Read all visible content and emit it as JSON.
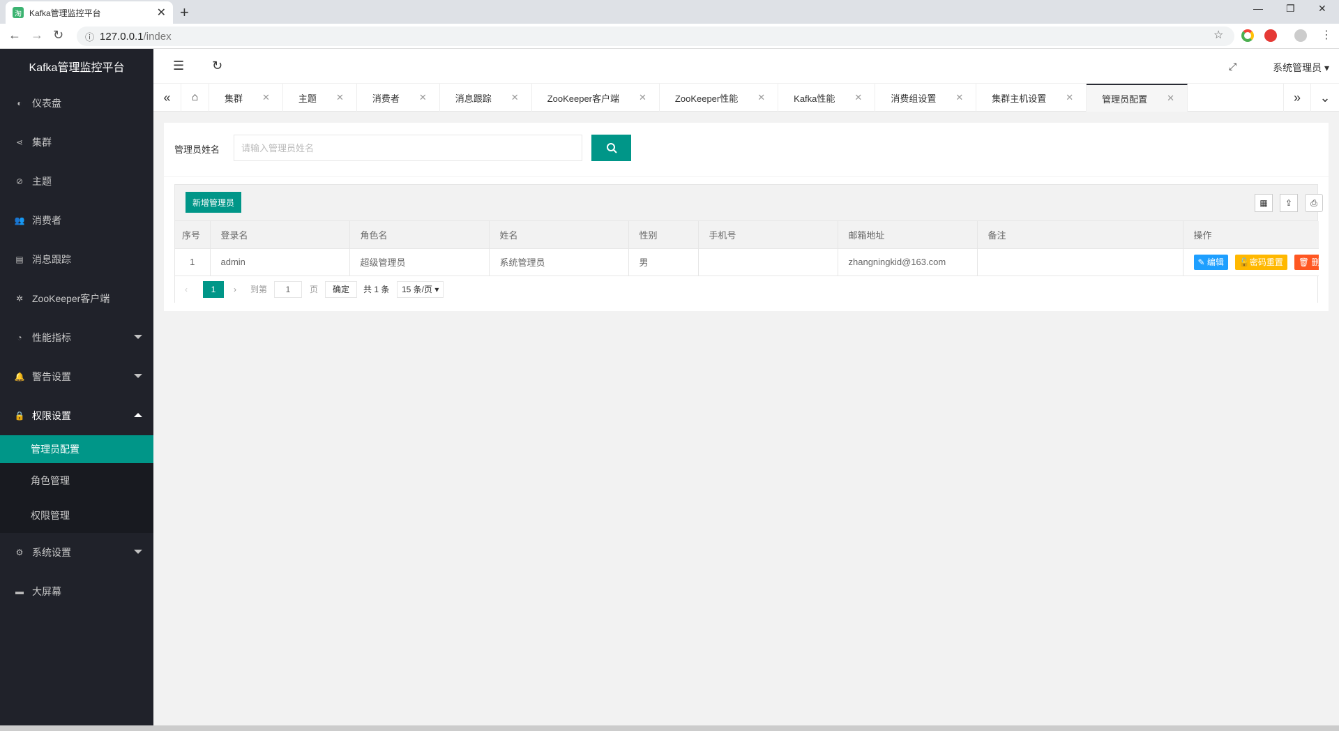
{
  "browser": {
    "tab_title": "Kafka管理监控平台",
    "tab_favicon": "淘",
    "url_host": "127.0.0.1",
    "url_path": "/index"
  },
  "sidebar": {
    "logo": "Kafka管理监控平台",
    "items": [
      {
        "label": "仪表盘",
        "icon": "◐"
      },
      {
        "label": "集群",
        "icon": "⋖"
      },
      {
        "label": "主题",
        "icon": "⊘"
      },
      {
        "label": "消费者",
        "icon": "👥"
      },
      {
        "label": "消息跟踪",
        "icon": "▤"
      },
      {
        "label": "ZooKeeper客户端",
        "icon": "✲"
      },
      {
        "label": "性能指标",
        "icon": "◔"
      },
      {
        "label": "警告设置",
        "icon": "🔔"
      },
      {
        "label": "权限设置",
        "icon": "🔒"
      },
      {
        "label": "系统设置",
        "icon": "⚙"
      },
      {
        "label": "大屏幕",
        "icon": "▬"
      }
    ],
    "submenu": [
      {
        "label": "管理员配置"
      },
      {
        "label": "角色管理"
      },
      {
        "label": "权限管理"
      }
    ]
  },
  "header": {
    "user": "系统管理员"
  },
  "pagetabs": [
    {
      "label": "集群"
    },
    {
      "label": "主题"
    },
    {
      "label": "消费者"
    },
    {
      "label": "消息跟踪"
    },
    {
      "label": "ZooKeeper客户端"
    },
    {
      "label": "ZooKeeper性能"
    },
    {
      "label": "Kafka性能"
    },
    {
      "label": "消费组设置"
    },
    {
      "label": "集群主机设置"
    },
    {
      "label": "管理员配置"
    }
  ],
  "search": {
    "label": "管理员姓名",
    "placeholder": "请输入管理员姓名"
  },
  "table": {
    "add_label": "新增管理员",
    "columns": [
      "序号",
      "登录名",
      "角色名",
      "姓名",
      "性别",
      "手机号",
      "邮箱地址",
      "备注",
      "操作"
    ],
    "rows": [
      {
        "no": "1",
        "login": "admin",
        "role": "超级管理员",
        "name": "系统管理员",
        "gender": "男",
        "phone": "",
        "email": "zhangningkid@163.com",
        "note": ""
      }
    ],
    "actions": {
      "edit": "编辑",
      "reset": "密码重置",
      "delete": "删除"
    }
  },
  "pager": {
    "current": "1",
    "goto_label": "到第",
    "goto_value": "1",
    "page_unit": "页",
    "confirm": "确定",
    "total": "共 1 条",
    "page_size": "15 条/页"
  }
}
